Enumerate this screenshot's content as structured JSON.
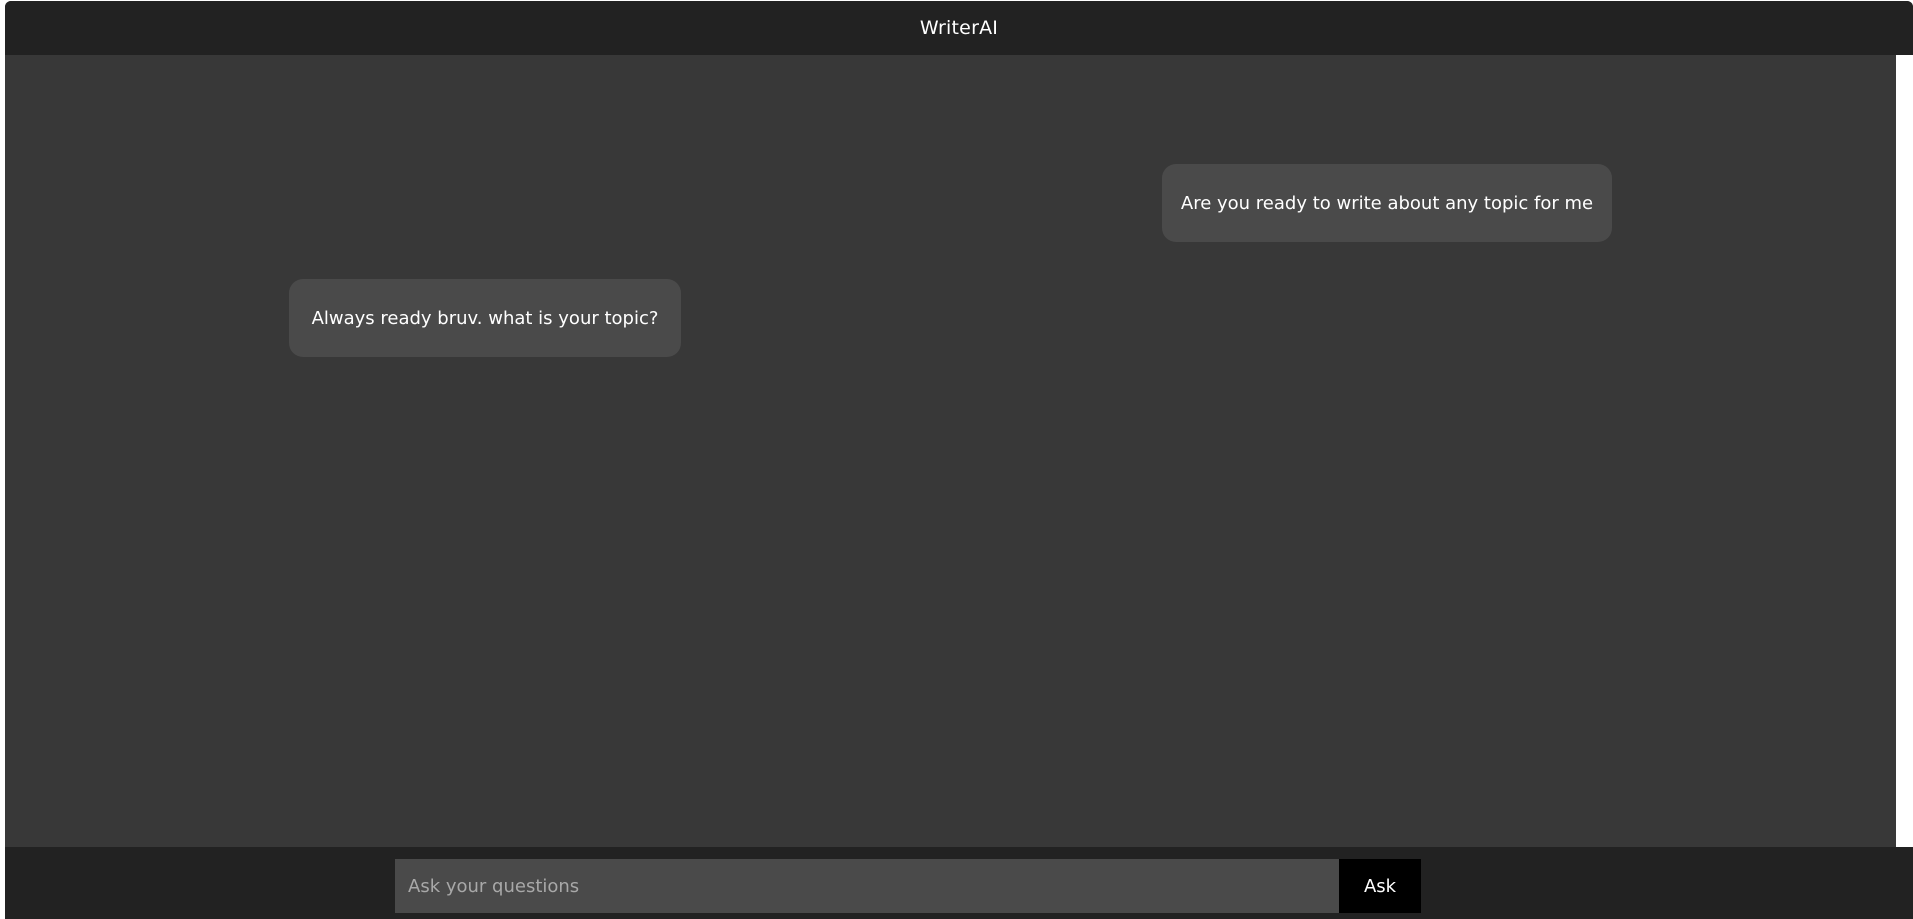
{
  "header": {
    "title": "WriterAI"
  },
  "messages": [
    {
      "role": "user",
      "text": "Are you ready to write about any topic for me"
    },
    {
      "role": "bot",
      "text": "Always ready bruv. what is your topic?"
    }
  ],
  "composer": {
    "placeholder": "Ask your questions",
    "value": "",
    "submit_label": "Ask"
  },
  "colors": {
    "header_bg": "#222222",
    "chat_bg": "#383838",
    "bubble_bg": "#4a4a4a",
    "button_bg": "#000000",
    "text": "#ffffff"
  }
}
